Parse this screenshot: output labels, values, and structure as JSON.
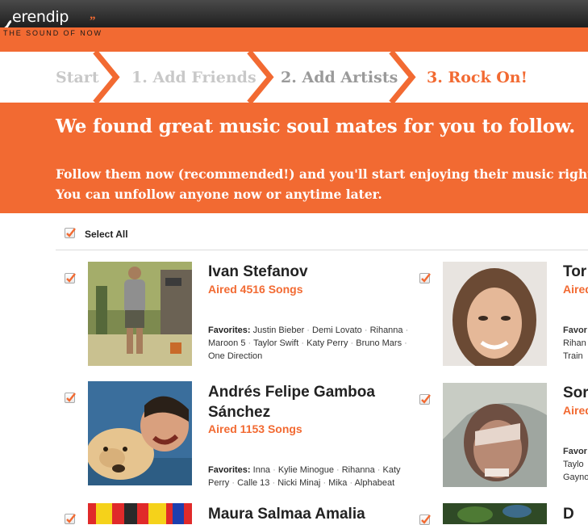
{
  "brand": {
    "name": "erendip",
    "tagline": "THE SOUND OF NOW",
    "quote_mark": "”"
  },
  "steps": {
    "start": "Start",
    "step1": "1.  Add Friends",
    "step2": "2.  Add Artists",
    "step3": "3.  Rock On!"
  },
  "banner": {
    "title": "We found great music soul mates for you to follow.",
    "line1": "Follow them now (recommended!) and you'll start enjoying their music right aw",
    "line2": "You can unfollow anyone now or anytime later."
  },
  "select_all": {
    "label": "Select All",
    "checked": true
  },
  "favorites_label": "Favorites:",
  "users": [
    {
      "name_line1": "Ivan Stefanov",
      "name_line2": "",
      "aired": "Aired 4516 Songs",
      "favorites": [
        "Justin Bieber",
        "Demi Lovato",
        "Rihanna",
        "Maroon 5",
        "Taylor Swift",
        "Katy Perry",
        "Bruno Mars",
        "One Direction"
      ],
      "checked": true
    },
    {
      "name_line1": "Tor",
      "name_line2": "",
      "aired": "Aired",
      "favorites_visible": [
        "Favor",
        "Rihan",
        "Train"
      ],
      "checked": true
    },
    {
      "name_line1": "Andrés Felipe Gamboa",
      "name_line2": "Sánchez",
      "aired": "Aired 1153 Songs",
      "favorites": [
        "Inna",
        "Kylie Minogue",
        "Rihanna",
        "Katy Perry",
        "Calle 13",
        "Nicki Minaj",
        "Mika",
        "Alphabeat"
      ],
      "checked": true
    },
    {
      "name_line1": "Sor",
      "name_line2": "",
      "aired": "Aired",
      "favorites_visible": [
        "Favor",
        "Taylo",
        "Gayno"
      ],
      "checked": true
    },
    {
      "name_line1": "Maura Salmaa Amalia",
      "checked": true
    },
    {
      "name_line1": "D",
      "checked": true
    }
  ],
  "colors": {
    "accent": "#f26a32",
    "topbar": "#2b2b2b",
    "text": "#222222"
  }
}
